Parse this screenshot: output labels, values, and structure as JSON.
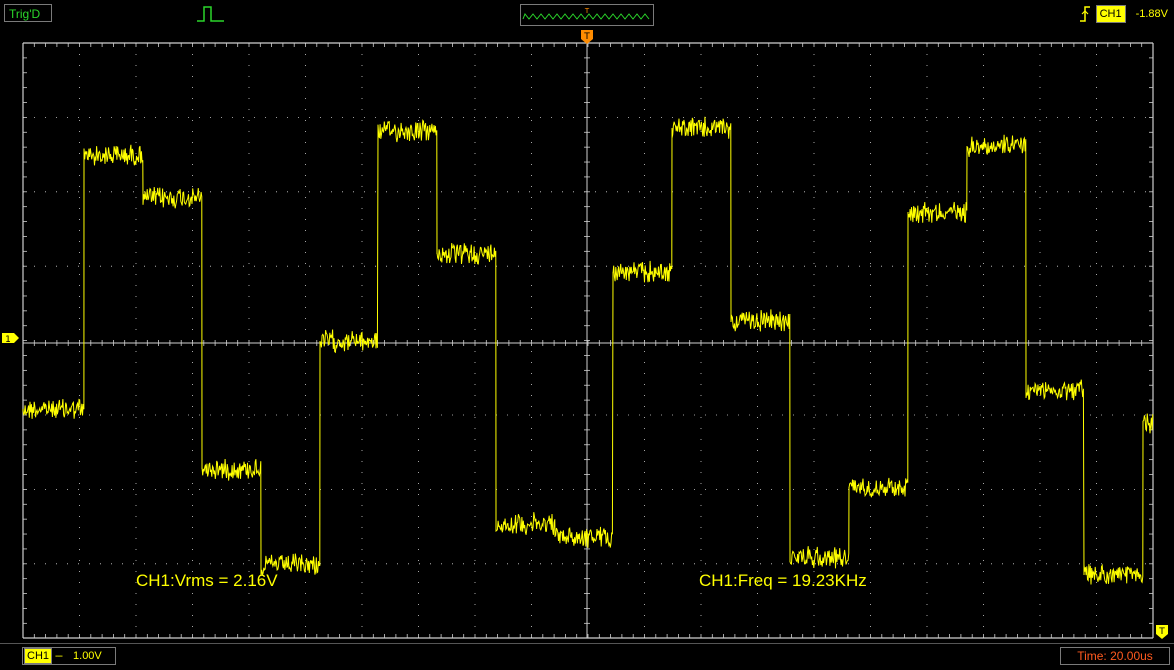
{
  "topbar": {
    "trigger_status": "Trig'D",
    "trigger_channel": "CH1",
    "trigger_level": "-1.88V",
    "overview_marker": "T"
  },
  "scope": {
    "trigger_marker": "T",
    "channel_marker": "1",
    "level_marker": "T",
    "measurements": [
      {
        "label": "CH1:Vrms = 2.16V"
      },
      {
        "label": "CH1:Freq = 19.23KHz"
      }
    ],
    "colors": {
      "trace": "#ffff00",
      "grid": "#cfcfcf",
      "marker": "#ff8c00"
    }
  },
  "bottombar": {
    "channel": "CH1",
    "coupling": "---",
    "volts_per_div": "1.00V",
    "timebase": "Time: 20.00us"
  }
}
